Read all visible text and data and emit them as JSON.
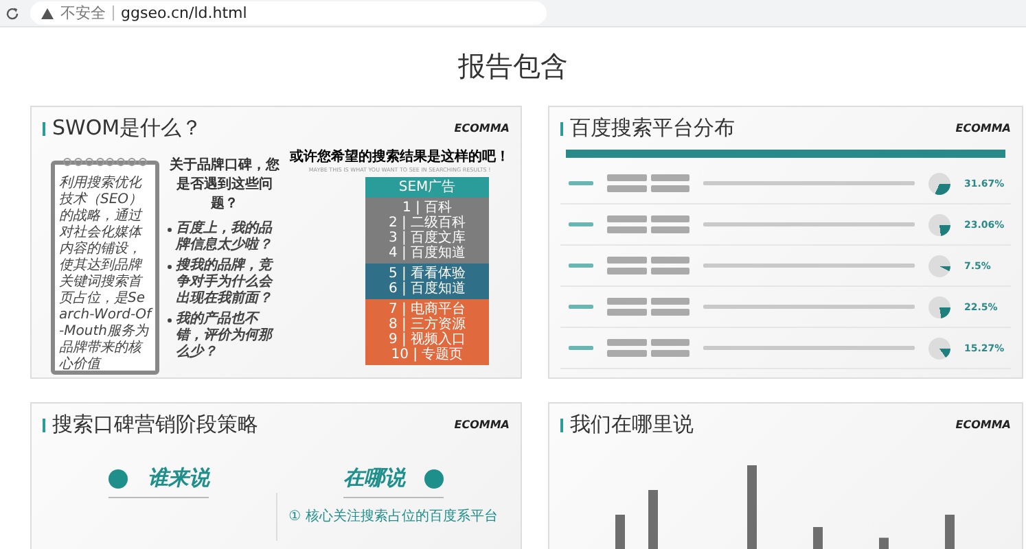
{
  "browser": {
    "security": "不安全",
    "url": "ggseo.cn/ld.html"
  },
  "page_title": "报告包含",
  "slides": [
    {
      "kind": "swom",
      "title": "SWOM是什么？",
      "logo": "ECOMMA",
      "note": "利用搜索优化技术（SEO）的战略，通过对社会化媒体内容的铺设，使其达到品牌关键词搜索首页占位，是Search-Word-Of-Mouth服务为品牌带来的核心价值",
      "question": "关于品牌口碑，您是否遇到这些问题？",
      "bullets": [
        "百度上，我的品牌信息太少啦？",
        "搜我的品牌，竞争对手为什么会出现在我前面？",
        "我的产品也不错，评价为何那么少？"
      ],
      "heading": "或许您希望的搜索结果是这样的吧！",
      "subheading": "MAYBE THIS IS WHAT YOU WANT TO SEE IN SEARCHING RESULTS !",
      "blocks": [
        {
          "color": "#2a9d9a",
          "lines": [
            "SEM广告"
          ]
        },
        {
          "color": "#7d7d7d",
          "lines": [
            "1 | 百科",
            "2 | 二级百科",
            "3 | 百度文库",
            "4 | 百度知道"
          ]
        },
        {
          "color": "#2f6f87",
          "lines": [
            "5 | 看看体验",
            "6 | 百度知道"
          ]
        },
        {
          "color": "#e0693e",
          "lines": [
            "7 | 电商平台",
            "8 | 三方资源",
            "9 | 视频入口",
            "10 | 专题页"
          ]
        }
      ]
    },
    {
      "kind": "platforms",
      "title": "百度搜索平台分布",
      "logo": "ECOMMA",
      "rows": [
        {
          "share": "31.67%"
        },
        {
          "share": "23.06%"
        },
        {
          "share": "7.5%"
        },
        {
          "share": "22.5%"
        },
        {
          "share": "15.27%"
        }
      ]
    },
    {
      "kind": "strategy",
      "title": "搜索口碑营销阶段策略",
      "logo": "ECOMMA",
      "who": "谁来说",
      "where": "在哪说",
      "point": "① 核心关注搜索占位的百度系平台"
    },
    {
      "kind": "chart",
      "title": "我们在哪里说",
      "logo": "ECOMMA"
    }
  ]
}
